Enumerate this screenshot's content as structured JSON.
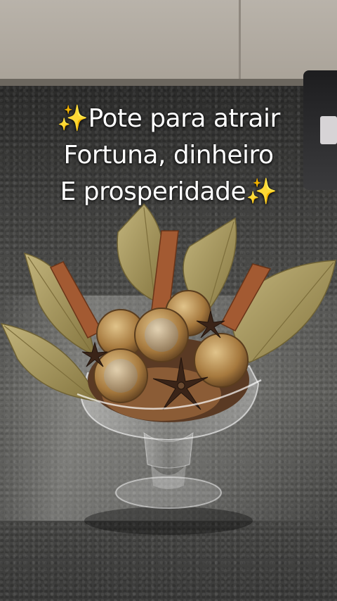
{
  "overlay": {
    "line1": "✨Pote para atrair",
    "line2": "Fortuna, dinheiro",
    "line3": "E prosperidade✨"
  },
  "colors": {
    "bay_leaf": "#a99a60",
    "cinnamon": "#a35a32",
    "coin_gold": "#b7894a",
    "coin_silver": "#b9b2a7",
    "star_anise": "#3a2418",
    "counter": "#4a4a48"
  }
}
